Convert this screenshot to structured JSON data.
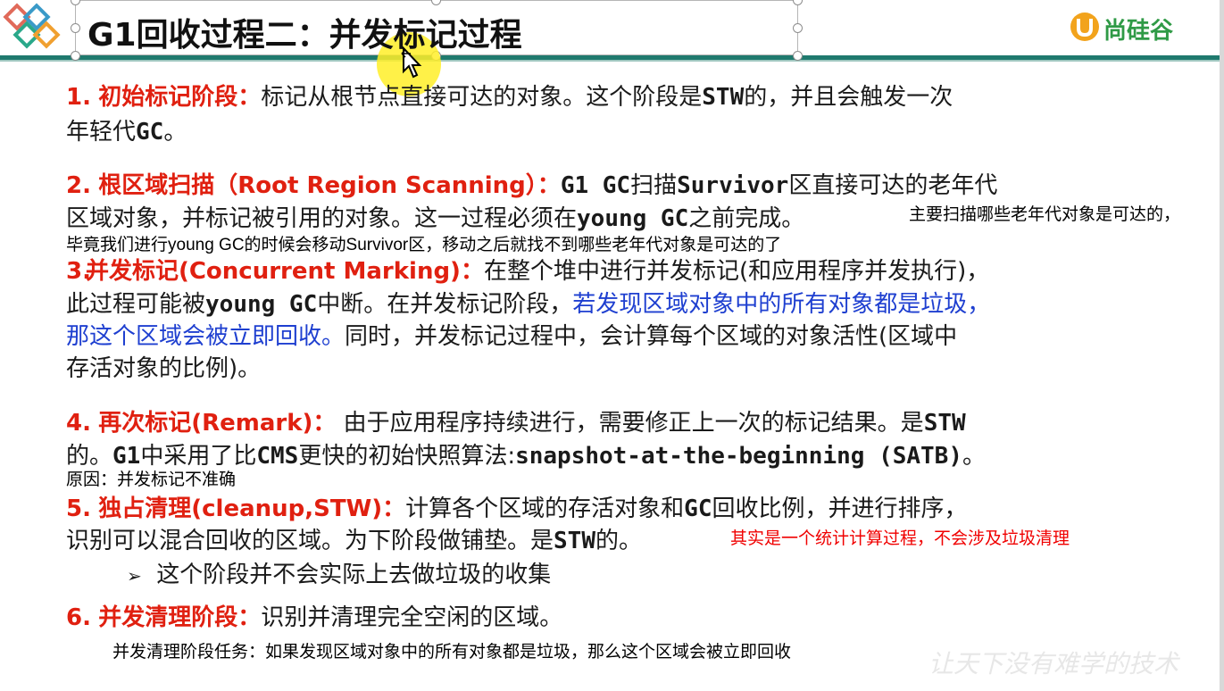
{
  "header": {
    "title": "G1回收过程二：并发标记过程",
    "brand": "尚硅谷"
  },
  "items": [
    {
      "num": "1.",
      "title": "初始标记阶段：",
      "text": "标记从根节点直接可达的对象。这个阶段是",
      "stw": "STW",
      "text2": "的，并且会触发一次",
      "line2a": "年轻代",
      "line2b": "GC",
      "line2c": "。"
    },
    {
      "num": "2.",
      "title": "根区域扫描（Root Region Scanning）：",
      "text": "G1 GC",
      "text2": "扫描",
      "survivor": "Survivor",
      "text3": "区直接可达的老年代",
      "line2a": "区域对象，并标记被引用的对象。这一过程必须在",
      "line2b": "young GC",
      "line2c": "之前完成。"
    },
    {
      "num": "3.",
      "title": "并发标记(Concurrent Marking)：",
      "text": "在整个堆中进行并发标记(和应用程序并发执行)，",
      "line2a": "此过程可能被",
      "line2b": "young GC",
      "line2c": "中断。在并发标记阶段，",
      "line2d": "若发现区域对象中的所有对象都是垃圾，",
      "line3a": "那这个区域会被立即回收。",
      "line3b": "同时，并发标记过程中，会计算每个区域的对象活性(区域中",
      "line4": "存活对象的比例)。"
    },
    {
      "num": "4.",
      "title": "再次标记(Remark)：",
      "text": "由于应用程序持续进行，需要修正上一次的标记结果。是",
      "stw": "STW",
      "line2a": "的。",
      "line2b": "G1",
      "line2c": "中采用了比",
      "line2d": "CMS",
      "line2e": "更快的初始快照算法:",
      "line2f": "snapshot-at-the-beginning (SATB)",
      "line2g": "。"
    },
    {
      "num": "5.",
      "title": "独占清理(cleanup,STW)：",
      "text": "计算各个区域的存活对象和",
      "gc": "GC",
      "text2": "回收比例，并进行排序，",
      "line2a": "识别可以混合回收的区域。为下阶段做铺垫。是",
      "line2b": "STW",
      "line2c": "的。",
      "sub": "这个阶段并不会实际上去做垃圾的收集",
      "bullet": "➢"
    },
    {
      "num": "6.",
      "title": "并发清理阶段：",
      "text": "识别并清理完全空闲的区域。"
    }
  ],
  "notes": {
    "n1": "主要扫描哪些老年代对象是可达的，",
    "n2": "毕竟我们进行young GC的时候会移动Survivor区，移动之后就找不到哪些老年代对象是可达的了",
    "n3": "原因：并发标记不准确",
    "n4": "其实是一个统计计算过程，不会涉及垃圾清理",
    "n5": "并发清理阶段任务：如果发现区域对象中的所有对象都是垃圾，那么这个区域会被立即回收"
  },
  "watermark": "让天下没有难学的技术",
  "colors": {
    "accent_red": "#e02010",
    "accent_blue": "#1e3fd0",
    "header_line": "#1f7a6e",
    "brand_green": "#2f9a46",
    "note_red": "#f00000"
  }
}
